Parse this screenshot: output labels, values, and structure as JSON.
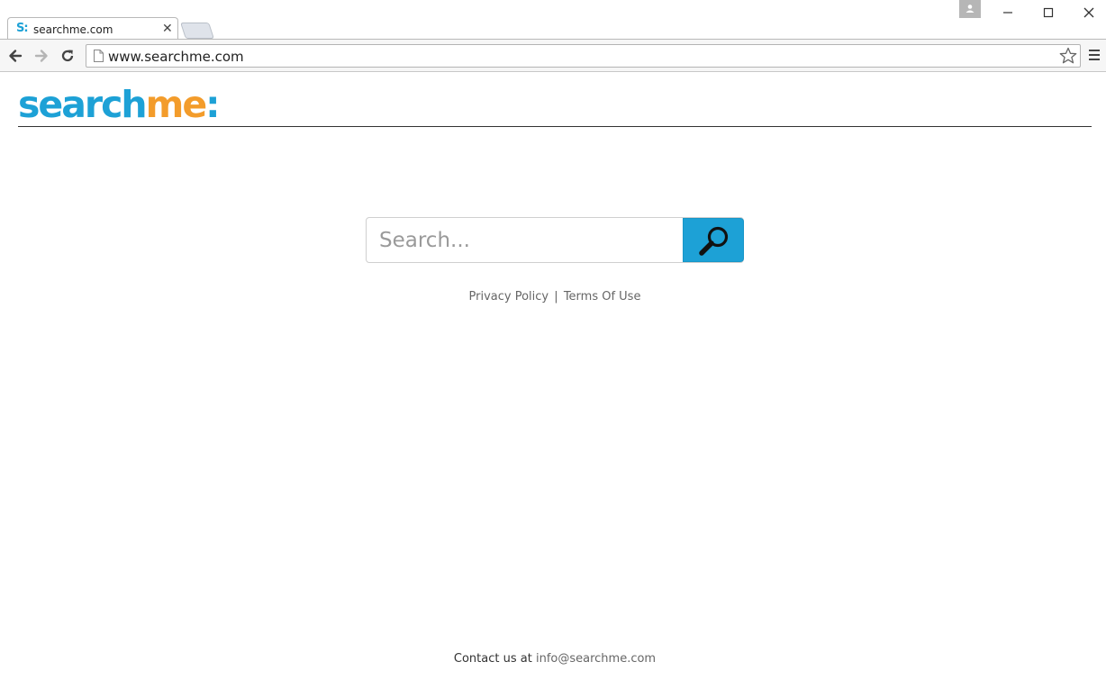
{
  "browser": {
    "tab": {
      "title": "searchme.com",
      "favicon_text": "S:"
    },
    "address_bar": {
      "url": "www.searchme.com"
    },
    "icons": [
      "back-arrow-icon",
      "forward-arrow-icon",
      "reload-icon",
      "page-icon",
      "star-icon",
      "menu-icon",
      "close-icon",
      "minimize-icon",
      "maximize-icon",
      "profile-icon"
    ]
  },
  "header": {
    "logo": {
      "part1": "search",
      "part2": "me",
      "part3": ":"
    },
    "colors": {
      "logo_blue": "#1da1d6",
      "logo_orange": "#f39c2b"
    }
  },
  "search": {
    "placeholder": "Search...",
    "button_icon": "magnifier-icon",
    "button_color": "#1da1d6"
  },
  "links": {
    "privacy": "Privacy Policy",
    "separator": "|",
    "terms": "Terms Of Use"
  },
  "footer": {
    "contact_prefix": "Contact us at",
    "email": "info@searchme.com"
  }
}
